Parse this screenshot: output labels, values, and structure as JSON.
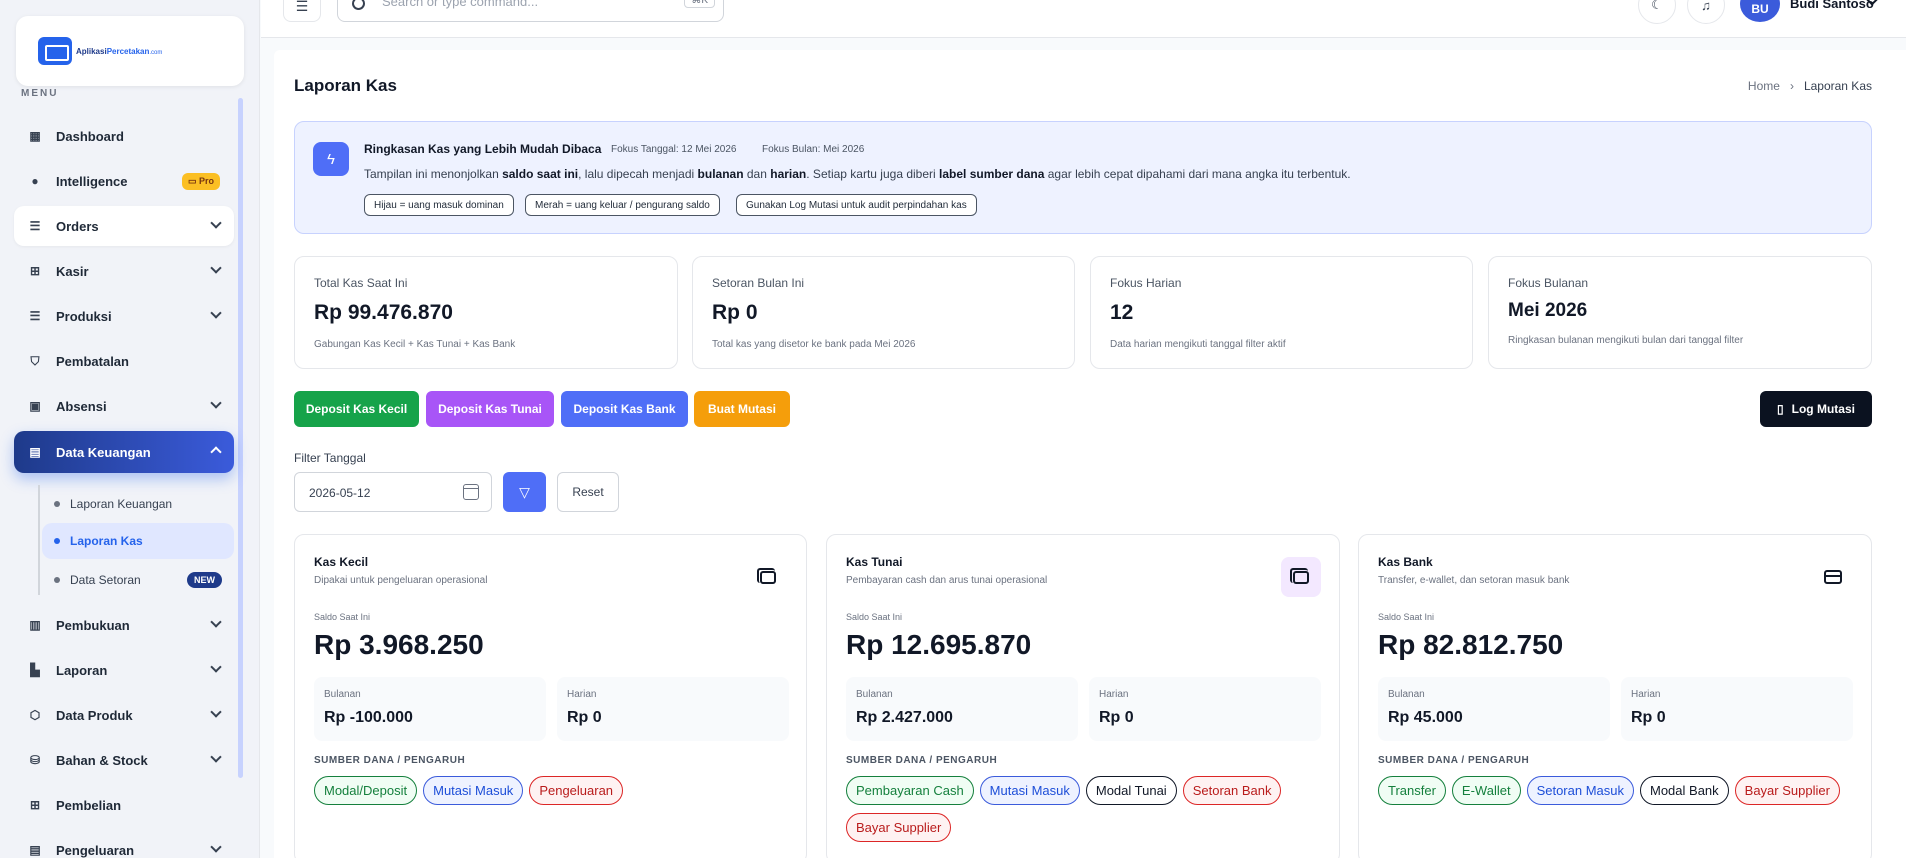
{
  "brand": {
    "part1": "Aplikasi",
    "part2": "Percetakan",
    "part3": ".com"
  },
  "sidebar": {
    "menu_label": "MENU",
    "items": [
      {
        "label": "Dashboard"
      },
      {
        "label": "Intelligence",
        "badge": "Pro"
      },
      {
        "label": "Orders"
      },
      {
        "label": "Kasir"
      },
      {
        "label": "Produksi"
      },
      {
        "label": "Pembatalan"
      },
      {
        "label": "Absensi"
      },
      {
        "label": "Data Keuangan"
      },
      {
        "label": "Pembukuan"
      },
      {
        "label": "Laporan"
      },
      {
        "label": "Data Produk"
      },
      {
        "label": "Bahan & Stock"
      },
      {
        "label": "Pembelian"
      },
      {
        "label": "Pengeluaran"
      }
    ],
    "sub_items": [
      {
        "label": "Laporan Keuangan"
      },
      {
        "label": "Laporan Kas"
      },
      {
        "label": "Data Setoran",
        "badge": "NEW"
      }
    ]
  },
  "topbar": {
    "search_placeholder": "Search or type command...",
    "shortcut": "⌘K",
    "avatar_initials": "BU",
    "user_name": "Budi Santoso"
  },
  "page": {
    "title": "Laporan Kas",
    "breadcrumb": [
      "Home",
      "Laporan Kas"
    ]
  },
  "info": {
    "title": "Ringkasan Kas yang Lebih Mudah Dibaca",
    "focus_date": "Fokus Tanggal: 12 Mei 2026",
    "focus_month": "Fokus Bulan: Mei 2026",
    "desc": {
      "t1": "Tampilan ini menonjolkan ",
      "b1": "saldo saat ini",
      "t2": ", lalu dipecah menjadi ",
      "b2": "bulanan",
      "t3": " dan ",
      "b3": "harian",
      "t4": ". Setiap kartu juga diberi ",
      "b4": "label sumber dana",
      "t5": " agar lebih cepat dipahami dari mana angka itu terbentuk."
    },
    "chips": [
      "Hijau = uang masuk dominan",
      "Merah = uang keluar / pengurang saldo",
      "Gunakan Log Mutasi untuk audit perpindahan kas"
    ]
  },
  "stats": [
    {
      "label": "Total Kas Saat Ini",
      "value": "Rp 99.476.870",
      "sub": "Gabungan Kas Kecil + Kas Tunai + Kas Bank"
    },
    {
      "label": "Setoran Bulan Ini",
      "value": "Rp 0",
      "sub": "Total kas yang disetor ke bank pada Mei 2026"
    },
    {
      "label": "Fokus Harian",
      "value": "12",
      "sub": "Data harian mengikuti tanggal filter aktif"
    },
    {
      "label": "Fokus Bulanan",
      "value": "Mei 2026",
      "sub": "Ringkasan bulanan mengikuti bulan dari tanggal filter"
    }
  ],
  "actions": {
    "deposit_kecil": "Deposit Kas Kecil",
    "deposit_tunai": "Deposit Kas Tunai",
    "deposit_bank": "Deposit Kas Bank",
    "mutasi": "Buat Mutasi",
    "log": "Log Mutasi"
  },
  "filter": {
    "label": "Filter Tanggal",
    "date": "2026-05-12",
    "reset": "Reset"
  },
  "kas": [
    {
      "title": "Kas Kecil",
      "desc": "Dipakai untuk pengeluaran operasional",
      "saldo_label": "Saldo Saat Ini",
      "saldo": "Rp 3.968.250",
      "bulanan_label": "Bulanan",
      "bulanan": "Rp -100.000",
      "harian_label": "Harian",
      "harian": "Rp 0",
      "source_label": "SUMBER DANA / PENGARUH",
      "tags": [
        {
          "label": "Modal/Deposit",
          "color": "green"
        },
        {
          "label": "Mutasi Masuk",
          "color": "blue"
        },
        {
          "label": "Pengeluaran",
          "color": "red"
        }
      ]
    },
    {
      "title": "Kas Tunai",
      "desc": "Pembayaran cash dan arus tunai operasional",
      "saldo_label": "Saldo Saat Ini",
      "saldo": "Rp 12.695.870",
      "bulanan_label": "Bulanan",
      "bulanan": "Rp 2.427.000",
      "harian_label": "Harian",
      "harian": "Rp 0",
      "source_label": "SUMBER DANA / PENGARUH",
      "tags": [
        {
          "label": "Pembayaran Cash",
          "color": "green"
        },
        {
          "label": "Mutasi Masuk",
          "color": "blue"
        },
        {
          "label": "Modal Tunai",
          "color": "dark"
        },
        {
          "label": "Setoran Bank",
          "color": "red"
        },
        {
          "label": "Bayar Supplier",
          "color": "red"
        }
      ]
    },
    {
      "title": "Kas Bank",
      "desc": "Transfer, e-wallet, dan setoran masuk bank",
      "saldo_label": "Saldo Saat Ini",
      "saldo": "Rp 82.812.750",
      "bulanan_label": "Bulanan",
      "bulanan": "Rp 45.000",
      "harian_label": "Harian",
      "harian": "Rp 0",
      "source_label": "SUMBER DANA / PENGARUH",
      "tags": [
        {
          "label": "Transfer",
          "color": "green"
        },
        {
          "label": "E-Wallet",
          "color": "green"
        },
        {
          "label": "Setoran Masuk",
          "color": "blue"
        },
        {
          "label": "Modal Bank",
          "color": "dark"
        },
        {
          "label": "Bayar Supplier",
          "color": "red"
        }
      ]
    }
  ],
  "colors": {
    "accent": "#4f6ef7",
    "green": "#16a34a",
    "purple": "#a855f7",
    "blue": "#4f6ef7",
    "orange": "#f59e0b",
    "dark": "#0b1220"
  }
}
